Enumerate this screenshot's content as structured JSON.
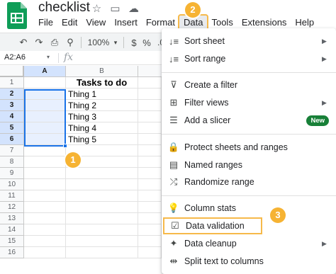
{
  "doc": {
    "title": "checklist"
  },
  "title_icons": [
    {
      "name": "star-icon",
      "glyph": "☆"
    },
    {
      "name": "move-folder-icon",
      "glyph": "▭"
    },
    {
      "name": "cloud-status-icon",
      "glyph": "☁"
    }
  ],
  "menus": [
    "File",
    "Edit",
    "View",
    "Insert",
    "Format",
    "Data",
    "Tools",
    "Extensions",
    "Help"
  ],
  "active_menu": "Data",
  "toolbar": {
    "undo": "↶",
    "redo": "↷",
    "print": "⎙",
    "paint_format": "⚲",
    "zoom": "100%",
    "zoom_arrow": "▾",
    "currency": "$",
    "percent": "%",
    "decimal_decrease": ".0"
  },
  "formula_bar": {
    "name_box": "A2:A6",
    "name_box_arrow": "▾",
    "fx": "fx"
  },
  "grid": {
    "columns": [
      "A",
      "B"
    ],
    "rows": [
      "1",
      "2",
      "3",
      "4",
      "5",
      "6",
      "7",
      "8",
      "9",
      "10",
      "11",
      "12",
      "13",
      "14",
      "15",
      "16"
    ],
    "cells": {
      "B1": "Tasks to do",
      "B2": "Thing 1",
      "B3": "Thing 2",
      "B4": "Thing 3",
      "B5": "Thing 4",
      "B6": "Thing 5"
    },
    "selection": "A2:A6"
  },
  "callouts": [
    "1",
    "2",
    "3"
  ],
  "data_menu": {
    "items": [
      {
        "label": "Sort sheet",
        "icon": "sort-sheet-icon",
        "glyph": "↓≡",
        "arrow": "▶"
      },
      {
        "label": "Sort range",
        "icon": "sort-range-icon",
        "glyph": "↓≡",
        "arrow": "▶"
      },
      {
        "label": "Create a filter",
        "icon": "filter-icon",
        "glyph": "⊽"
      },
      {
        "label": "Filter views",
        "icon": "filter-views-icon",
        "glyph": "⊞",
        "arrow": "▶"
      },
      {
        "label": "Add a slicer",
        "icon": "slicer-icon",
        "glyph": "☰",
        "badge": "New"
      },
      {
        "label": "Protect sheets and ranges",
        "icon": "lock-icon",
        "glyph": "🔒"
      },
      {
        "label": "Named ranges",
        "icon": "named-ranges-icon",
        "glyph": "▤"
      },
      {
        "label": "Randomize range",
        "icon": "shuffle-icon",
        "glyph": "⤮"
      },
      {
        "label": "Column stats",
        "icon": "lightbulb-icon",
        "glyph": "💡"
      },
      {
        "label": "Data validation",
        "icon": "data-validation-icon",
        "glyph": "☑"
      },
      {
        "label": "Data cleanup",
        "icon": "magic-wand-icon",
        "glyph": "✦",
        "arrow": "▶"
      },
      {
        "label": "Split text to columns",
        "icon": "split-columns-icon",
        "glyph": "⇹"
      }
    ]
  },
  "colors": {
    "accent": "#1a73e8",
    "callout": "#f6b333",
    "new_badge": "#188038",
    "sheets_green": "#0f9d58"
  }
}
